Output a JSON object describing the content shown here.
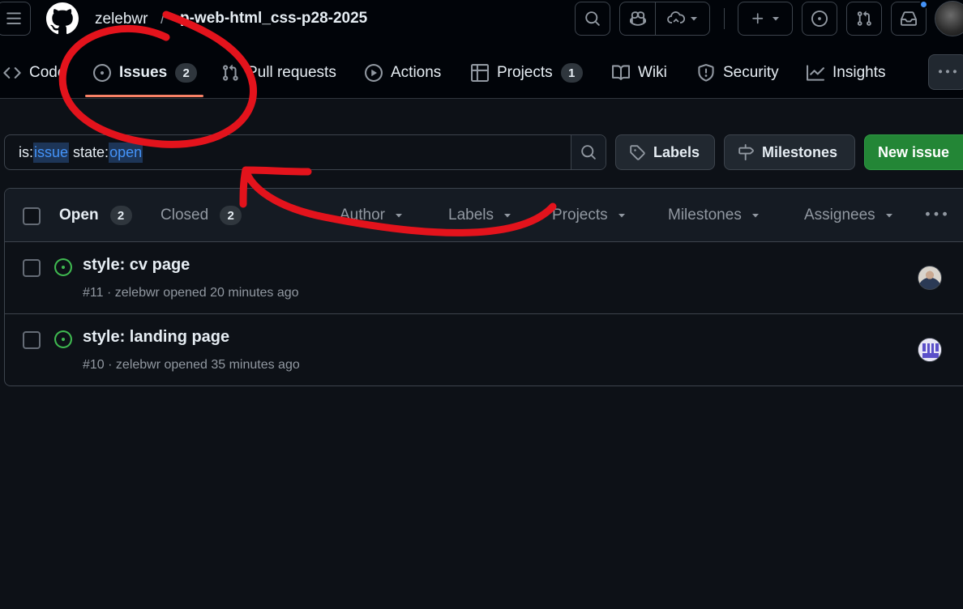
{
  "header": {
    "owner": "zelebwr",
    "separator": "/",
    "repo": "p-web-html_css-p28-2025"
  },
  "tabs": [
    {
      "label": "Code"
    },
    {
      "label": "Issues",
      "count": "2",
      "selected": true
    },
    {
      "label": "Pull requests"
    },
    {
      "label": "Actions"
    },
    {
      "label": "Projects",
      "count": "1"
    },
    {
      "label": "Wiki"
    },
    {
      "label": "Security"
    },
    {
      "label": "Insights"
    }
  ],
  "search": {
    "prefix1": "is:",
    "value1": "issue",
    "prefix2": " state:",
    "value2": "open"
  },
  "buttons": {
    "labels": "Labels",
    "milestones": "Milestones",
    "new_issue": "New issue"
  },
  "list_header": {
    "open_label": "Open",
    "open_count": "2",
    "closed_label": "Closed",
    "closed_count": "2",
    "filters": [
      "Author",
      "Labels",
      "Projects",
      "Milestones",
      "Assignees"
    ]
  },
  "issues": [
    {
      "title": "style: cv page",
      "meta": "#11 · zelebwr opened 20 minutes ago",
      "avatar": "photo"
    },
    {
      "title": "style: landing page",
      "meta": "#10 · zelebwr opened 35 minutes ago",
      "avatar": "identicon"
    }
  ],
  "colors": {
    "background": "#0d1117",
    "header_bg": "#010409",
    "accent_underline": "#f78166",
    "open_icon": "#3fb950",
    "primary_button": "#238636",
    "query_highlight": "#4493f8",
    "annotation": "#e3131c"
  }
}
